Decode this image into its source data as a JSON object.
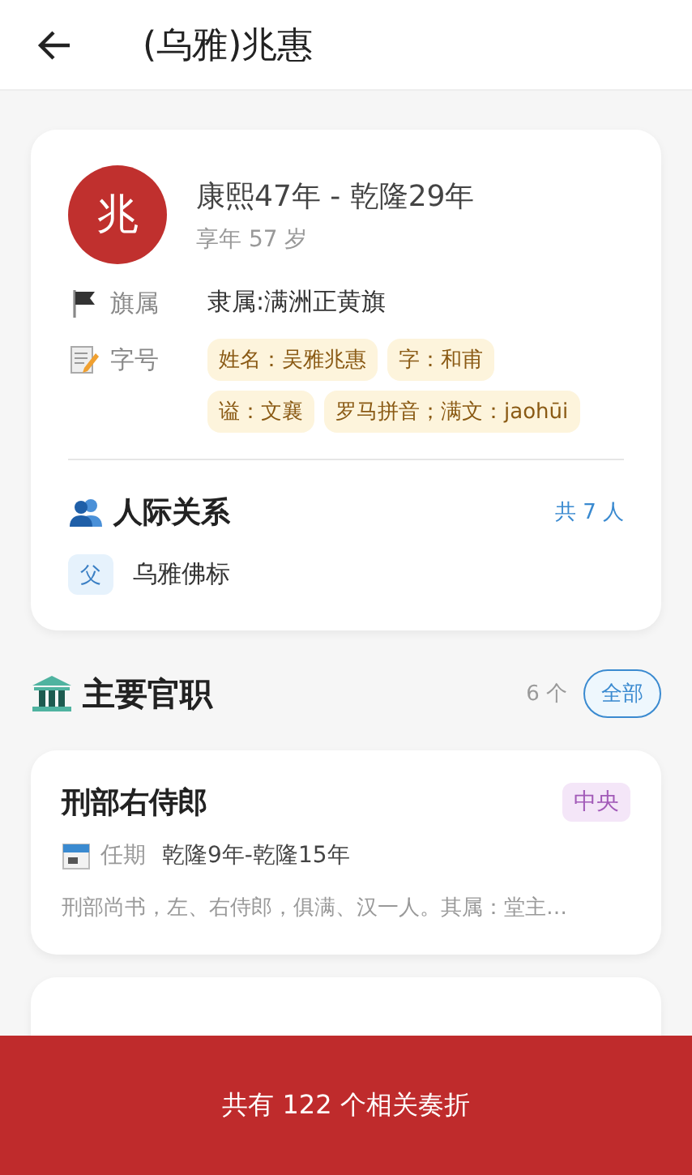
{
  "header": {
    "title": "(乌雅)兆惠"
  },
  "profile": {
    "avatar": "兆",
    "years": "康熙47年 - 乾隆29年",
    "age": "享年 57 岁",
    "fields": [
      {
        "kind": "text",
        "label": "旗属",
        "value": "隶属:满洲正黄旗"
      },
      {
        "kind": "tags",
        "label": "字号",
        "tags": [
          "姓名：吴雅兆惠",
          "字：和甫",
          "谥：文襄",
          "罗马拼音；满文：jaohūi"
        ]
      }
    ],
    "relations": {
      "title": "人际关系",
      "count": "共 7 人",
      "items": [
        {
          "relation": "父",
          "name": "乌雅佛标"
        }
      ]
    }
  },
  "offices": {
    "title": "主要官职",
    "count": "6 个",
    "all_button": "全部",
    "items": [
      {
        "title": "刑部右侍郎",
        "tag": "中央",
        "term_label": "任期",
        "term": "乾隆9年-乾隆15年",
        "description": "刑部尚书，左、右侍郎，俱满、汉一人。其属：堂主…"
      }
    ],
    "more_below": true
  },
  "bottom_bar": {
    "text": "共有 122 个相关奏折"
  }
}
